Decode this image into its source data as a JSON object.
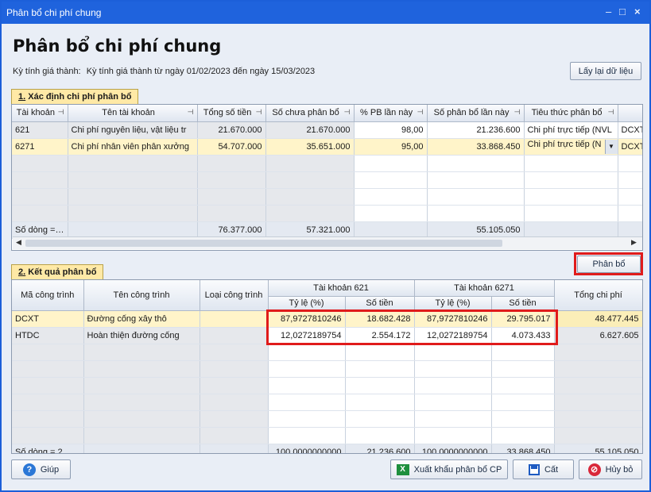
{
  "window": {
    "title": "Phân bổ chi phí chung",
    "minimize_glyph": "–",
    "maximize_glyph": "□",
    "close_glyph": "×"
  },
  "header": {
    "heading": "Phân bổ chi phí chung",
    "period_label": "Kỳ tính giá thành:",
    "period_value": "Kỳ tính giá thành từ ngày 01/02/2023 đến ngày 15/03/2023",
    "reload_button": "Lấy lại dữ liệu"
  },
  "section1": {
    "tab_number": "1.",
    "tab_label": "Xác định chi phí phân bổ",
    "columns": [
      "Tài khoản",
      "Tên tài khoản",
      "Tổng số tiền",
      "Số chưa phân bổ",
      "% PB lần này",
      "Số phân bổ lần này",
      "Tiêu thức phân bổ",
      ""
    ],
    "rows": [
      {
        "account": "621",
        "name": "Chi phí nguyên liệu, vật liệu tr",
        "total": "21.670.000",
        "unallocated": "21.670.000",
        "percent": "98,00",
        "allocated": "21.236.600",
        "criteria": "Chi phí trực tiếp (NVL",
        "extra": "DCXT"
      },
      {
        "account": "6271",
        "name": "Chi phí nhân viên phân xưởng",
        "total": "54.707.000",
        "unallocated": "35.651.000",
        "percent": "95,00",
        "allocated": "33.868.450",
        "criteria": "Chi phí trực tiếp (N",
        "extra": "DCXT"
      }
    ],
    "footer": {
      "count": "Số dòng =…",
      "total": "76.377.000",
      "unallocated": "57.321.000",
      "allocated": "55.105.050"
    }
  },
  "allocate_button": "Phân bổ",
  "section2": {
    "tab_number": "2.",
    "tab_label": "Kết quả phân bổ",
    "col_code": "Mã công trình",
    "col_name": "Tên công trình",
    "col_type": "Loại công trình",
    "group1": "Tài khoản 621",
    "group2": "Tài khoản 6271",
    "sub_rate": "Tỷ lệ (%)",
    "sub_amount": "Số tiền",
    "col_total": "Tổng chi phí",
    "rows": [
      {
        "code": "DCXT",
        "name": "Đường cống xây thô",
        "type": "",
        "rate1": "87,9727810246",
        "amount1": "18.682.428",
        "rate2": "87,9727810246",
        "amount2": "29.795.017",
        "total": "48.477.445"
      },
      {
        "code": "HTDC",
        "name": "Hoàn thiện đường cống",
        "type": "",
        "rate1": "12,0272189754",
        "amount1": "2.554.172",
        "rate2": "12,0272189754",
        "amount2": "4.073.433",
        "total": "6.627.605"
      }
    ],
    "footer": {
      "count": "Số dòng = 2",
      "rate1": "100,0000000000",
      "amount1": "21.236.600",
      "rate2": "100,0000000000",
      "amount2": "33.868.450",
      "total": "55.105.050"
    }
  },
  "footer_buttons": {
    "help": "Giúp",
    "export": "Xuất khẩu phân bổ CP",
    "save": "Cất",
    "cancel": "Hủy bỏ"
  },
  "colors": {
    "titlebar": "#1f63dd",
    "selected_row": "#fff4c9",
    "highlight_box": "#e01b1b"
  }
}
